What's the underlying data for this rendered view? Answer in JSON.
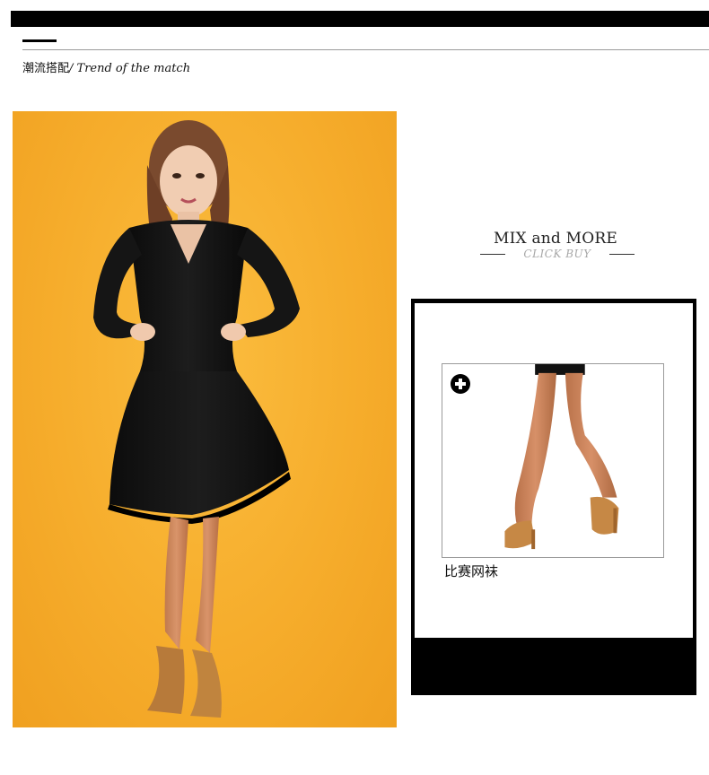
{
  "section": {
    "title_zh": "潮流搭配",
    "title_sep": "/ ",
    "title_en": "Trend of the match"
  },
  "mix": {
    "title": "MIX and MORE",
    "subtitle": "CLICK BUY"
  },
  "product": {
    "name": "比赛网袜",
    "action_icon": "plus-circle-icon"
  },
  "colors": {
    "background": "#ffffff",
    "bar": "#000000",
    "photo_background": "#f6ad2c",
    "subtitle": "#a8a8a8"
  }
}
